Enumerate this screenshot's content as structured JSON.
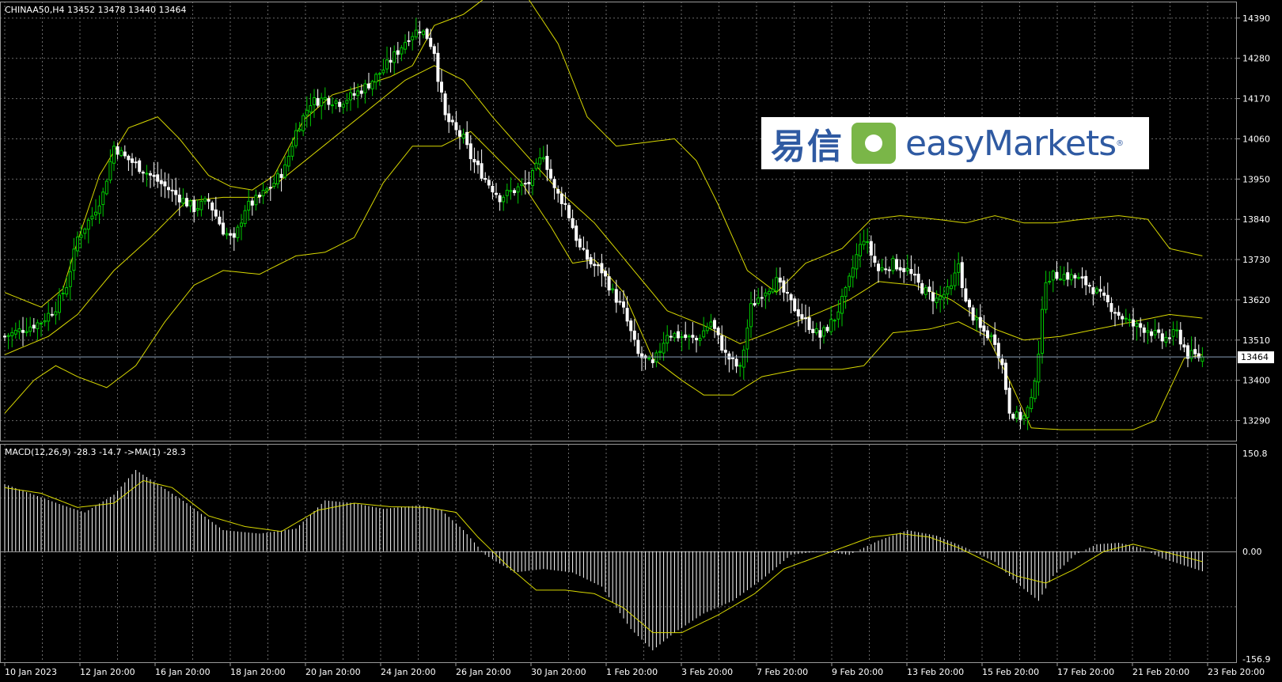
{
  "header": {
    "symbol_info": "CHINAA50,H4  13452 13478 13440 13464",
    "macd_info": "MACD(12,26,9) -28.3 -14.7  ->MA(1) -28.3"
  },
  "price_axis": {
    "labels": [
      "14390",
      "14280",
      "14170",
      "14060",
      "13950",
      "13840",
      "13730",
      "13620",
      "13510",
      "13400",
      "13290"
    ],
    "current_price": "13464"
  },
  "macd_axis": {
    "labels": [
      "150.8",
      "0.00",
      "-156.9"
    ]
  },
  "time_axis": {
    "labels": [
      "10 Jan 2023",
      "12 Jan 20:00",
      "16 Jan 20:00",
      "18 Jan 20:00",
      "20 Jan 20:00",
      "24 Jan 20:00",
      "26 Jan 20:00",
      "30 Jan 20:00",
      "1 Feb 20:00",
      "3 Feb 20:00",
      "7 Feb 20:00",
      "9 Feb 20:00",
      "13 Feb 20:00",
      "15 Feb 20:00",
      "17 Feb 20:00",
      "21 Feb 20:00",
      "23 Feb 20:00"
    ]
  },
  "logo": {
    "cn_text": "易信",
    "en_text": "easyMarkets",
    "reg": "®"
  },
  "colors": {
    "bull": "#00c800",
    "bear": "#ffffff",
    "bands": "#d8d800",
    "grid": "#6a6a6a",
    "signal": "#d8d800"
  },
  "chart_data": {
    "type": "candlestick",
    "timeframe": "H4",
    "y_range": [
      13235,
      14435
    ],
    "macd_range": [
      -156.9,
      150.8
    ],
    "macd_parameters": [
      12,
      26,
      9
    ],
    "last": {
      "open": 13452,
      "high": 13478,
      "low": 13440,
      "close": 13464
    },
    "macd_last": -28.3,
    "signal_last": -14.7,
    "close_path": [
      [
        0,
        13520
      ],
      [
        5,
        13540
      ],
      [
        10,
        13560
      ],
      [
        14,
        13600
      ],
      [
        17,
        13660
      ],
      [
        20,
        13790
      ],
      [
        24,
        13850
      ],
      [
        27,
        13910
      ],
      [
        30,
        14040
      ],
      [
        33,
        14010
      ],
      [
        36,
        13990
      ],
      [
        40,
        13960
      ],
      [
        44,
        13930
      ],
      [
        48,
        13900
      ],
      [
        52,
        13870
      ],
      [
        56,
        13890
      ],
      [
        60,
        13810
      ],
      [
        63,
        13780
      ],
      [
        66,
        13870
      ],
      [
        70,
        13900
      ],
      [
        74,
        13940
      ],
      [
        77,
        13980
      ],
      [
        80,
        14080
      ],
      [
        84,
        14160
      ],
      [
        88,
        14170
      ],
      [
        92,
        14160
      ],
      [
        96,
        14180
      ],
      [
        100,
        14210
      ],
      [
        104,
        14250
      ],
      [
        108,
        14300
      ],
      [
        111,
        14340
      ],
      [
        114,
        14360
      ],
      [
        116,
        14340
      ],
      [
        118,
        14300
      ],
      [
        119,
        14230
      ],
      [
        121,
        14120
      ],
      [
        124,
        14080
      ],
      [
        126,
        14060
      ],
      [
        128,
        14010
      ],
      [
        132,
        13950
      ],
      [
        136,
        13900
      ],
      [
        140,
        13920
      ],
      [
        144,
        13940
      ],
      [
        148,
        14020
      ],
      [
        151,
        13920
      ],
      [
        154,
        13880
      ],
      [
        156,
        13820
      ],
      [
        158,
        13760
      ],
      [
        161,
        13720
      ],
      [
        164,
        13700
      ],
      [
        167,
        13640
      ],
      [
        170,
        13590
      ],
      [
        174,
        13470
      ],
      [
        178,
        13440
      ],
      [
        182,
        13530
      ],
      [
        186,
        13520
      ],
      [
        190,
        13510
      ],
      [
        194,
        13560
      ],
      [
        198,
        13470
      ],
      [
        202,
        13430
      ],
      [
        205,
        13600
      ],
      [
        208,
        13640
      ],
      [
        212,
        13670
      ],
      [
        216,
        13610
      ],
      [
        220,
        13560
      ],
      [
        224,
        13520
      ],
      [
        228,
        13570
      ],
      [
        231,
        13640
      ],
      [
        234,
        13740
      ],
      [
        236,
        13790
      ],
      [
        240,
        13700
      ],
      [
        244,
        13720
      ],
      [
        248,
        13700
      ],
      [
        252,
        13650
      ],
      [
        256,
        13620
      ],
      [
        260,
        13650
      ],
      [
        262,
        13720
      ],
      [
        264,
        13610
      ],
      [
        268,
        13540
      ],
      [
        272,
        13510
      ],
      [
        274,
        13440
      ],
      [
        276,
        13320
      ],
      [
        278,
        13300
      ],
      [
        280,
        13300
      ],
      [
        282,
        13340
      ],
      [
        284,
        13480
      ],
      [
        286,
        13680
      ],
      [
        290,
        13690
      ],
      [
        294,
        13680
      ],
      [
        298,
        13660
      ],
      [
        302,
        13620
      ],
      [
        306,
        13580
      ],
      [
        310,
        13550
      ],
      [
        314,
        13540
      ],
      [
        318,
        13510
      ],
      [
        322,
        13530
      ],
      [
        325,
        13470
      ],
      [
        329,
        13464
      ]
    ],
    "bb_upper_path": [
      [
        0,
        13640
      ],
      [
        10,
        13600
      ],
      [
        16,
        13650
      ],
      [
        20,
        13780
      ],
      [
        26,
        13960
      ],
      [
        34,
        14090
      ],
      [
        42,
        14120
      ],
      [
        48,
        14060
      ],
      [
        56,
        13960
      ],
      [
        62,
        13930
      ],
      [
        68,
        13920
      ],
      [
        74,
        13960
      ],
      [
        82,
        14110
      ],
      [
        90,
        14180
      ],
      [
        100,
        14210
      ],
      [
        106,
        14230
      ],
      [
        112,
        14260
      ],
      [
        118,
        14370
      ],
      [
        126,
        14400
      ],
      [
        134,
        14460
      ],
      [
        142,
        14470
      ],
      [
        152,
        14320
      ],
      [
        160,
        14120
      ],
      [
        168,
        14040
      ],
      [
        176,
        14050
      ],
      [
        184,
        14060
      ],
      [
        190,
        14000
      ],
      [
        196,
        13880
      ],
      [
        204,
        13700
      ],
      [
        212,
        13640
      ],
      [
        220,
        13720
      ],
      [
        230,
        13760
      ],
      [
        238,
        13840
      ],
      [
        246,
        13850
      ],
      [
        256,
        13840
      ],
      [
        264,
        13830
      ],
      [
        272,
        13850
      ],
      [
        280,
        13830
      ],
      [
        288,
        13830
      ],
      [
        296,
        13840
      ],
      [
        306,
        13850
      ],
      [
        314,
        13840
      ],
      [
        320,
        13760
      ],
      [
        329,
        13740
      ]
    ],
    "bb_middle_path": [
      [
        0,
        13470
      ],
      [
        12,
        13520
      ],
      [
        20,
        13580
      ],
      [
        30,
        13700
      ],
      [
        40,
        13790
      ],
      [
        50,
        13890
      ],
      [
        60,
        13900
      ],
      [
        70,
        13900
      ],
      [
        80,
        13980
      ],
      [
        90,
        14060
      ],
      [
        100,
        14140
      ],
      [
        110,
        14220
      ],
      [
        118,
        14260
      ],
      [
        126,
        14220
      ],
      [
        134,
        14120
      ],
      [
        142,
        14030
      ],
      [
        152,
        13920
      ],
      [
        162,
        13830
      ],
      [
        172,
        13710
      ],
      [
        182,
        13590
      ],
      [
        192,
        13550
      ],
      [
        202,
        13500
      ],
      [
        210,
        13530
      ],
      [
        220,
        13570
      ],
      [
        232,
        13620
      ],
      [
        240,
        13670
      ],
      [
        250,
        13660
      ],
      [
        260,
        13620
      ],
      [
        266,
        13580
      ],
      [
        272,
        13540
      ],
      [
        280,
        13510
      ],
      [
        290,
        13520
      ],
      [
        300,
        13540
      ],
      [
        310,
        13560
      ],
      [
        320,
        13580
      ],
      [
        329,
        13570
      ]
    ],
    "bb_lower_path": [
      [
        0,
        13310
      ],
      [
        8,
        13400
      ],
      [
        14,
        13440
      ],
      [
        20,
        13410
      ],
      [
        28,
        13380
      ],
      [
        36,
        13440
      ],
      [
        44,
        13560
      ],
      [
        52,
        13660
      ],
      [
        60,
        13700
      ],
      [
        70,
        13690
      ],
      [
        80,
        13740
      ],
      [
        88,
        13750
      ],
      [
        96,
        13790
      ],
      [
        104,
        13940
      ],
      [
        112,
        14040
      ],
      [
        120,
        14040
      ],
      [
        128,
        14080
      ],
      [
        136,
        14000
      ],
      [
        142,
        13940
      ],
      [
        150,
        13820
      ],
      [
        156,
        13720
      ],
      [
        162,
        13730
      ],
      [
        170,
        13640
      ],
      [
        178,
        13460
      ],
      [
        186,
        13400
      ],
      [
        192,
        13360
      ],
      [
        200,
        13360
      ],
      [
        208,
        13410
      ],
      [
        218,
        13430
      ],
      [
        230,
        13430
      ],
      [
        236,
        13440
      ],
      [
        244,
        13530
      ],
      [
        254,
        13540
      ],
      [
        262,
        13560
      ],
      [
        270,
        13520
      ],
      [
        276,
        13400
      ],
      [
        282,
        13270
      ],
      [
        290,
        13265
      ],
      [
        300,
        13265
      ],
      [
        310,
        13265
      ],
      [
        316,
        13290
      ],
      [
        324,
        13460
      ],
      [
        329,
        13470
      ]
    ],
    "macd_path": [
      [
        0,
        95
      ],
      [
        8,
        80
      ],
      [
        16,
        65
      ],
      [
        22,
        55
      ],
      [
        30,
        80
      ],
      [
        36,
        115
      ],
      [
        42,
        95
      ],
      [
        50,
        68
      ],
      [
        60,
        30
      ],
      [
        70,
        25
      ],
      [
        80,
        32
      ],
      [
        88,
        72
      ],
      [
        96,
        68
      ],
      [
        104,
        60
      ],
      [
        114,
        65
      ],
      [
        120,
        58
      ],
      [
        126,
        30
      ],
      [
        132,
        -5
      ],
      [
        140,
        -30
      ],
      [
        148,
        -25
      ],
      [
        156,
        -30
      ],
      [
        164,
        -50
      ],
      [
        172,
        -110
      ],
      [
        178,
        -140
      ],
      [
        184,
        -115
      ],
      [
        192,
        -88
      ],
      [
        200,
        -70
      ],
      [
        208,
        -40
      ],
      [
        216,
        -5
      ],
      [
        224,
        0
      ],
      [
        232,
        -5
      ],
      [
        240,
        15
      ],
      [
        248,
        30
      ],
      [
        256,
        22
      ],
      [
        264,
        5
      ],
      [
        272,
        -15
      ],
      [
        278,
        -45
      ],
      [
        284,
        -70
      ],
      [
        288,
        -35
      ],
      [
        294,
        -5
      ],
      [
        300,
        10
      ],
      [
        306,
        12
      ],
      [
        312,
        5
      ],
      [
        318,
        -10
      ],
      [
        324,
        -20
      ],
      [
        329,
        -28.3
      ]
    ],
    "signal_path": [
      [
        0,
        90
      ],
      [
        10,
        82
      ],
      [
        20,
        62
      ],
      [
        30,
        68
      ],
      [
        38,
        100
      ],
      [
        46,
        90
      ],
      [
        56,
        50
      ],
      [
        66,
        35
      ],
      [
        76,
        28
      ],
      [
        86,
        58
      ],
      [
        96,
        68
      ],
      [
        106,
        63
      ],
      [
        116,
        62
      ],
      [
        124,
        55
      ],
      [
        130,
        20
      ],
      [
        138,
        -20
      ],
      [
        146,
        -55
      ],
      [
        154,
        -55
      ],
      [
        162,
        -60
      ],
      [
        170,
        -80
      ],
      [
        178,
        -115
      ],
      [
        186,
        -115
      ],
      [
        196,
        -90
      ],
      [
        206,
        -60
      ],
      [
        214,
        -25
      ],
      [
        222,
        -10
      ],
      [
        230,
        5
      ],
      [
        238,
        20
      ],
      [
        246,
        25
      ],
      [
        254,
        20
      ],
      [
        262,
        5
      ],
      [
        270,
        -15
      ],
      [
        278,
        -35
      ],
      [
        286,
        -45
      ],
      [
        294,
        -25
      ],
      [
        302,
        0
      ],
      [
        310,
        10
      ],
      [
        318,
        0
      ],
      [
        329,
        -14.7
      ]
    ]
  }
}
